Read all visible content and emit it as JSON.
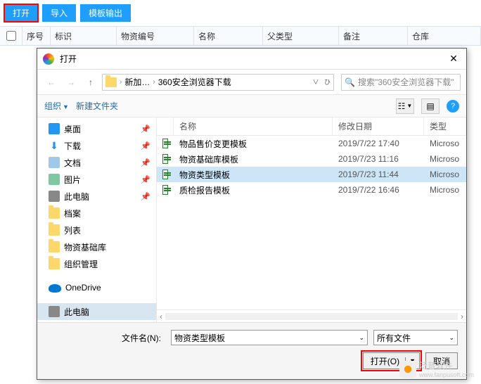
{
  "toolbar": {
    "open": "打开",
    "import": "导入",
    "template": "模板输出"
  },
  "grid_headers": {
    "seq": "序号",
    "id": "标识",
    "code": "物资编号",
    "name": "名称",
    "parent": "父类型",
    "note": "备注",
    "store": "仓库"
  },
  "dialog": {
    "title": "打开",
    "path_parts": [
      "新加…",
      "360安全浏览器下载"
    ],
    "search_placeholder": "搜索\"360安全浏览器下载\"",
    "organize": "组织",
    "new_folder": "新建文件夹",
    "tree": [
      {
        "label": "桌面",
        "icon": "desktop",
        "pin": true
      },
      {
        "label": "下载",
        "icon": "download",
        "pin": true
      },
      {
        "label": "文档",
        "icon": "doc",
        "pin": true
      },
      {
        "label": "图片",
        "icon": "pic",
        "pin": true
      },
      {
        "label": "此电脑",
        "icon": "pc",
        "pin": true
      },
      {
        "label": "档案",
        "icon": "folder",
        "pin": false
      },
      {
        "label": "列表",
        "icon": "folder",
        "pin": false
      },
      {
        "label": "物资基础库",
        "icon": "folder",
        "pin": false
      },
      {
        "label": "组织管理",
        "icon": "folder",
        "pin": false
      },
      {
        "label": "OneDrive",
        "icon": "cloud",
        "pin": false,
        "gapBefore": true
      },
      {
        "label": "此电脑",
        "icon": "pc",
        "pin": false,
        "selected": true,
        "gapBefore": true
      }
    ],
    "columns": {
      "name": "名称",
      "date": "修改日期",
      "type": "类型"
    },
    "files": [
      {
        "name": "物品售价变更模板",
        "date": "2019/7/22 17:40",
        "type": "Microso"
      },
      {
        "name": "物资基础库模板",
        "date": "2019/7/23 11:16",
        "type": "Microso"
      },
      {
        "name": "物资类型模板",
        "date": "2019/7/23 11:44",
        "type": "Microso",
        "selected": true
      },
      {
        "name": "质检报告模板",
        "date": "2019/7/22 16:46",
        "type": "Microso"
      }
    ],
    "footer": {
      "filename_label": "文件名(N):",
      "filename_value": "物资类型模板",
      "filter_value": "所有文件",
      "open_btn": "打开(O)",
      "cancel_btn": "取消"
    }
  },
  "watermark": {
    "text1": "泛普软件",
    "text2": "www.fanpusoft.com"
  }
}
